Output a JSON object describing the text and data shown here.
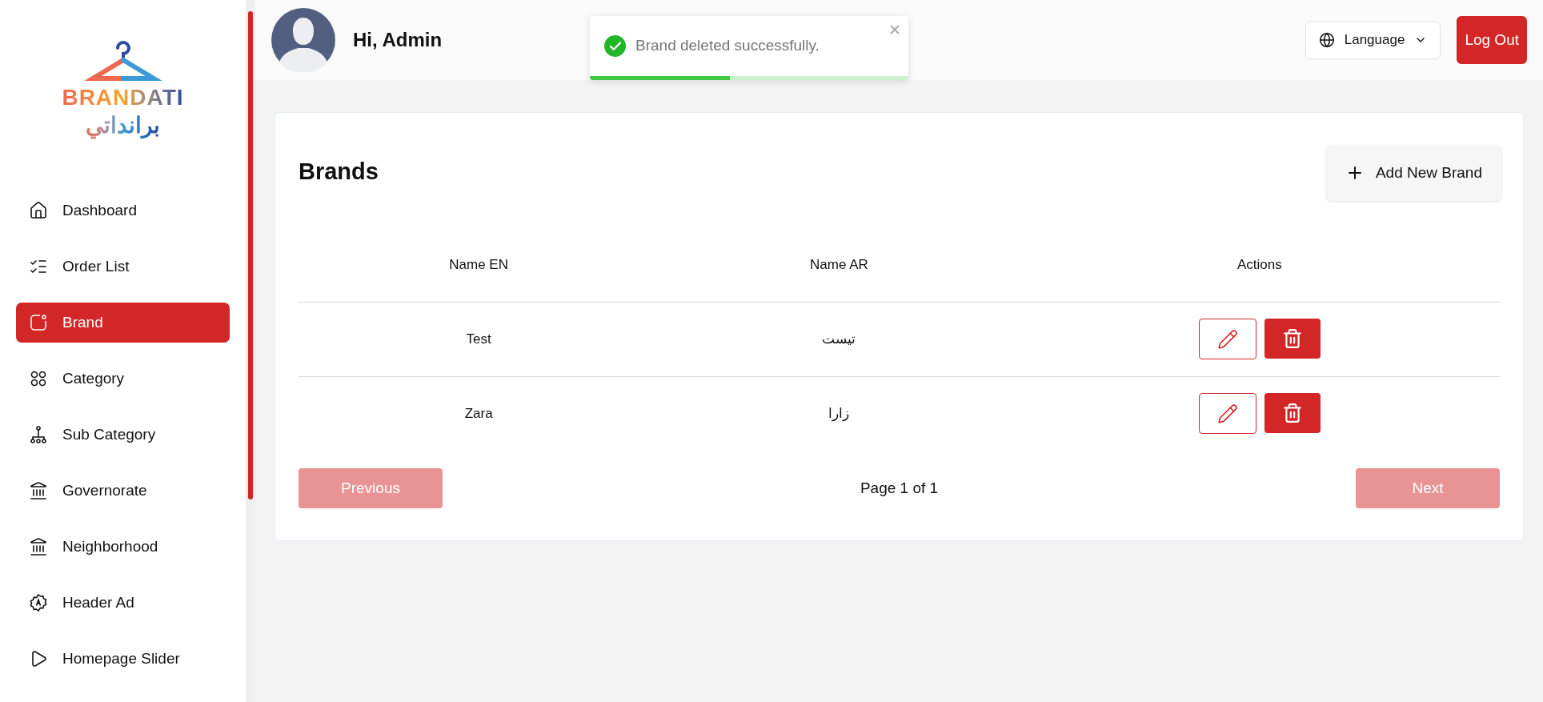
{
  "logo": {
    "latin": "BRANDATI",
    "arabic": "برانداتي"
  },
  "sidebar": {
    "items": [
      {
        "kind": "home",
        "label": "Dashboard",
        "selected": false
      },
      {
        "kind": "list",
        "label": "Order List",
        "selected": false
      },
      {
        "kind": "brand",
        "label": "Brand",
        "selected": true
      },
      {
        "kind": "grid",
        "label": "Category",
        "selected": false
      },
      {
        "kind": "tree",
        "label": "Sub Category",
        "selected": false
      },
      {
        "kind": "bank",
        "label": "Governorate",
        "selected": false
      },
      {
        "kind": "bank",
        "label": "Neighborhood",
        "selected": false
      },
      {
        "kind": "badge",
        "label": "Header Ad",
        "selected": false
      },
      {
        "kind": "play",
        "label": "Homepage Slider",
        "selected": false
      }
    ]
  },
  "header": {
    "greeting": "Hi, Admin",
    "language": "Language",
    "logout": "Log Out"
  },
  "toast": {
    "message": "Brand deleted successfully.",
    "level": 0.44
  },
  "page": {
    "title": "Brands",
    "add_button": "Add New Brand"
  },
  "table": {
    "columns": [
      "Name EN",
      "Name AR",
      "Actions"
    ],
    "rows": [
      {
        "name_en": "Test",
        "name_ar": "تيست"
      },
      {
        "name_en": "Zara",
        "name_ar": "زارا"
      }
    ]
  },
  "pagination": {
    "previous": {
      "label": "Previous",
      "disabled": true
    },
    "info": "Page 1 of 1",
    "next": {
      "label": "Next",
      "disabled": true
    }
  }
}
